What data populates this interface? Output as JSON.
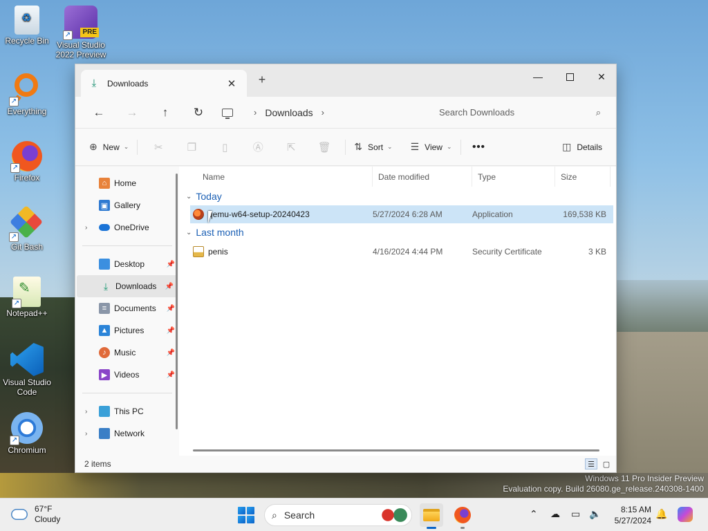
{
  "desktop": {
    "icons": [
      {
        "label": "Recycle Bin"
      },
      {
        "label": "Visual Studio 2022 Preview",
        "badge": "PRE"
      },
      {
        "label": "Everything"
      },
      {
        "label": "Firefox"
      },
      {
        "label": "Git Bash"
      },
      {
        "label": "Notepad++"
      },
      {
        "label": "Visual Studio Code"
      },
      {
        "label": "Chromium"
      }
    ],
    "watermark": {
      "line1": "Windows 11 Pro Insider Preview",
      "line2": "Evaluation copy. Build 26080.ge_release.240308-1400"
    }
  },
  "explorer": {
    "tab": {
      "title": "Downloads",
      "close": "✕"
    },
    "new_tab": "+",
    "window_controls": {
      "minimize": "—",
      "close": "✕"
    },
    "address": {
      "back": "←",
      "forward": "→",
      "up": "↑",
      "refresh": "↻",
      "breadcrumb": [
        "Downloads"
      ],
      "separator": "›"
    },
    "search": {
      "placeholder": "Search Downloads"
    },
    "commands": {
      "new": "New",
      "sort": "Sort",
      "view": "View",
      "more": "•••",
      "details": "Details"
    },
    "sidebar": {
      "quick": [
        {
          "label": "Home",
          "icon": "home-icon",
          "color": "#e8823a"
        },
        {
          "label": "Gallery",
          "icon": "gallery-icon",
          "color": "#2f7ad1"
        },
        {
          "label": "OneDrive",
          "icon": "onedrive-icon",
          "color": "#1a73d6",
          "expandable": true
        }
      ],
      "pinned": [
        {
          "label": "Desktop",
          "icon": "desktop-icon",
          "color": "#3b8fe0"
        },
        {
          "label": "Downloads",
          "icon": "downloads-icon",
          "color": "#17956f",
          "selected": true
        },
        {
          "label": "Documents",
          "icon": "documents-icon",
          "color": "#8a96a8"
        },
        {
          "label": "Pictures",
          "icon": "pictures-icon",
          "color": "#2b84d8"
        },
        {
          "label": "Music",
          "icon": "music-icon",
          "color": "#e06a3a"
        },
        {
          "label": "Videos",
          "icon": "videos-icon",
          "color": "#8a45c8"
        }
      ],
      "devices": [
        {
          "label": "This PC",
          "icon": "this-pc-icon",
          "color": "#3aa0d8"
        },
        {
          "label": "Network",
          "icon": "network-icon",
          "color": "#3a7fc6"
        }
      ]
    },
    "columns": [
      "Name",
      "Date modified",
      "Type",
      "Size"
    ],
    "groups": [
      {
        "label": "Today",
        "files": [
          {
            "name": "qemu-w64-setup-20240423",
            "date": "5/27/2024 6:28 AM",
            "type": "Application",
            "size": "169,538 KB",
            "selected": true,
            "icon": "qemu-app-icon"
          }
        ]
      },
      {
        "label": "Last month",
        "files": [
          {
            "name": "penis",
            "date": "4/16/2024 4:44 PM",
            "type": "Security Certificate",
            "size": "3 KB",
            "selected": false,
            "icon": "certificate-icon"
          }
        ]
      }
    ],
    "status": {
      "items_text": "2 items"
    }
  },
  "taskbar": {
    "weather": {
      "temp": "67°F",
      "condition": "Cloudy"
    },
    "search_label": "Search",
    "clock": {
      "time": "8:15 AM",
      "date": "5/27/2024"
    }
  }
}
